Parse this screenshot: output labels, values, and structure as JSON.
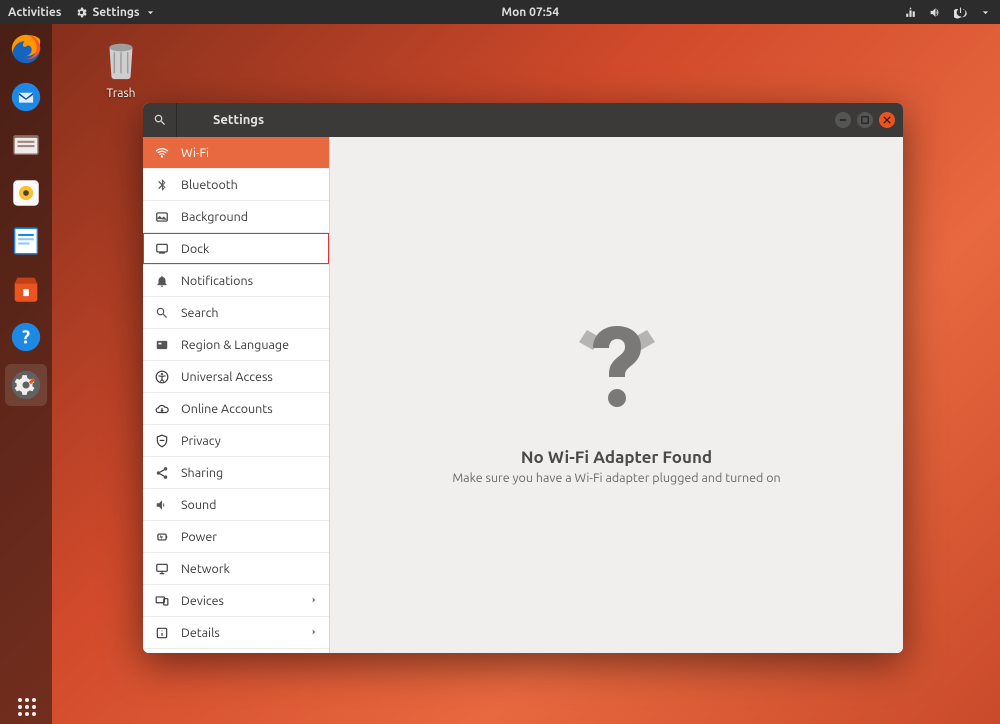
{
  "topbar": {
    "activities": "Activities",
    "app_menu": "Settings",
    "clock": "Mon 07:54"
  },
  "desktop": {
    "trash_label": "Trash"
  },
  "window": {
    "title": "Settings"
  },
  "sidebar": {
    "items": [
      {
        "label": "Wi-Fi",
        "icon": "wifi",
        "selected": true
      },
      {
        "label": "Bluetooth",
        "icon": "bluetooth"
      },
      {
        "label": "Background",
        "icon": "background"
      },
      {
        "label": "Dock",
        "icon": "dock",
        "highlighted": true
      },
      {
        "label": "Notifications",
        "icon": "bell"
      },
      {
        "label": "Search",
        "icon": "search"
      },
      {
        "label": "Region & Language",
        "icon": "region"
      },
      {
        "label": "Universal Access",
        "icon": "accessibility"
      },
      {
        "label": "Online Accounts",
        "icon": "cloud"
      },
      {
        "label": "Privacy",
        "icon": "privacy"
      },
      {
        "label": "Sharing",
        "icon": "share"
      },
      {
        "label": "Sound",
        "icon": "sound"
      },
      {
        "label": "Power",
        "icon": "power"
      },
      {
        "label": "Network",
        "icon": "network"
      },
      {
        "label": "Devices",
        "icon": "devices",
        "chevron": true
      },
      {
        "label": "Details",
        "icon": "details",
        "chevron": true
      }
    ]
  },
  "content": {
    "heading": "No Wi-Fi Adapter Found",
    "subtext": "Make sure you have a Wi-Fi adapter plugged and turned on"
  }
}
